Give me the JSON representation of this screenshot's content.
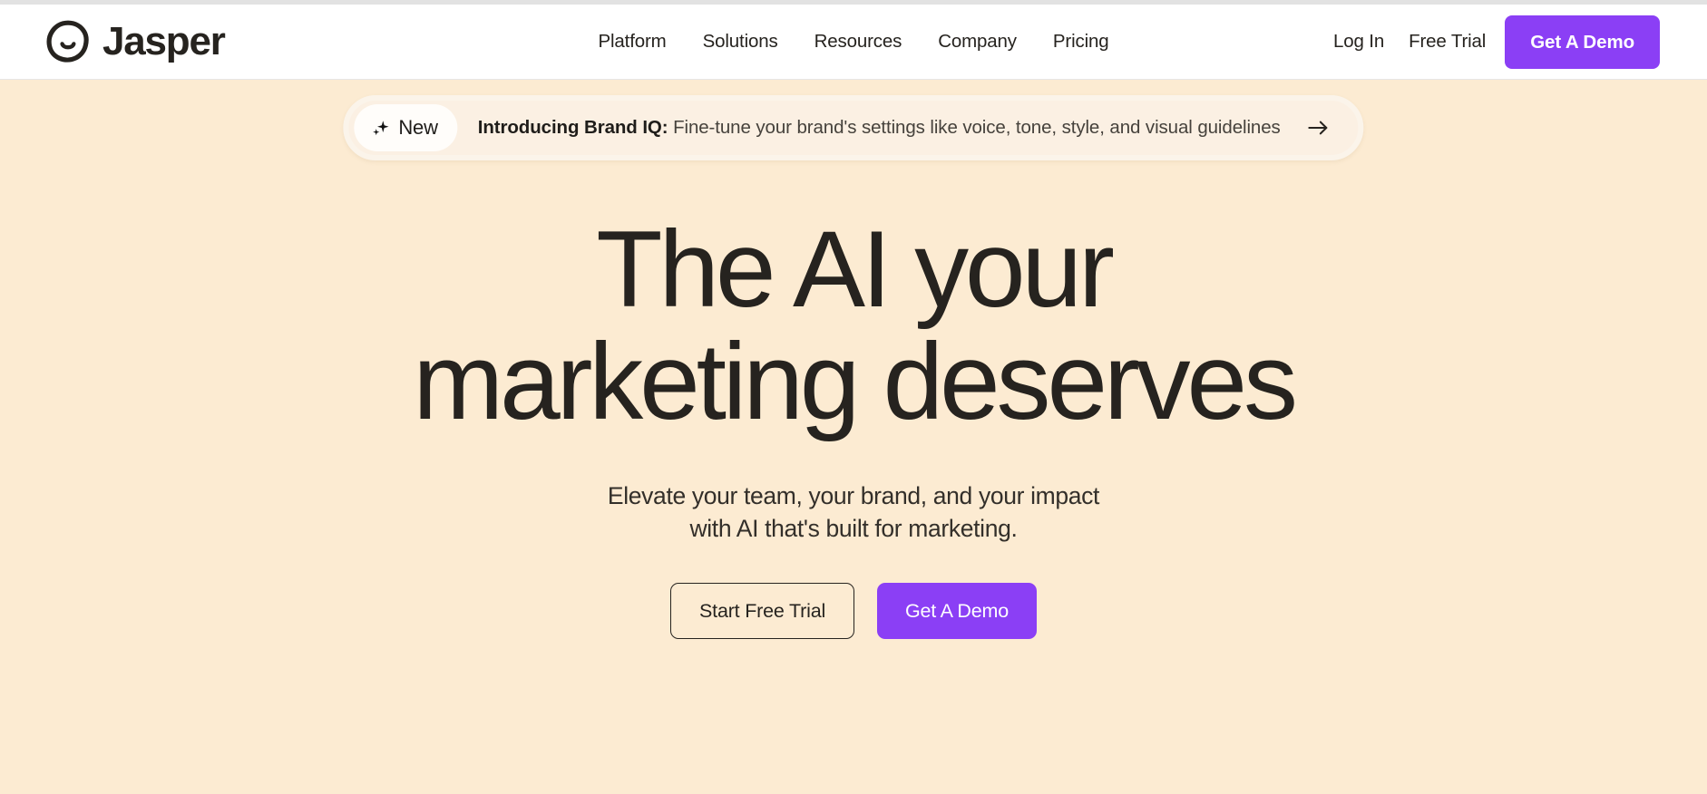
{
  "header": {
    "brand": {
      "name": "Jasper",
      "logo_icon": "jasper-smile-logo-icon"
    },
    "nav": [
      {
        "label": "Platform"
      },
      {
        "label": "Solutions"
      },
      {
        "label": "Resources"
      },
      {
        "label": "Company"
      },
      {
        "label": "Pricing"
      }
    ],
    "actions": {
      "login_label": "Log In",
      "free_trial_label": "Free Trial",
      "demo_label": "Get A Demo"
    }
  },
  "announcement": {
    "badge_label": "New",
    "badge_icon": "sparkle-icon",
    "lead": "Introducing Brand IQ:",
    "body": " Fine-tune your brand's settings like voice, tone, style, and visual guidelines",
    "arrow_icon": "arrow-right-icon"
  },
  "hero": {
    "title_line_1": "The AI your",
    "title_line_2": "marketing deserves",
    "sub_line_1": "Elevate your team, your brand, and your impact",
    "sub_line_2": "with AI that's built for marketing.",
    "cta_primary_label": "Start Free Trial",
    "cta_secondary_label": "Get A Demo"
  },
  "colors": {
    "hero_background": "#FCEBD2",
    "header_background": "#FFFFFF",
    "accent_purple": "#8B3FF5",
    "text_dark": "#26231F",
    "banner_background": "#FBF0E3"
  }
}
